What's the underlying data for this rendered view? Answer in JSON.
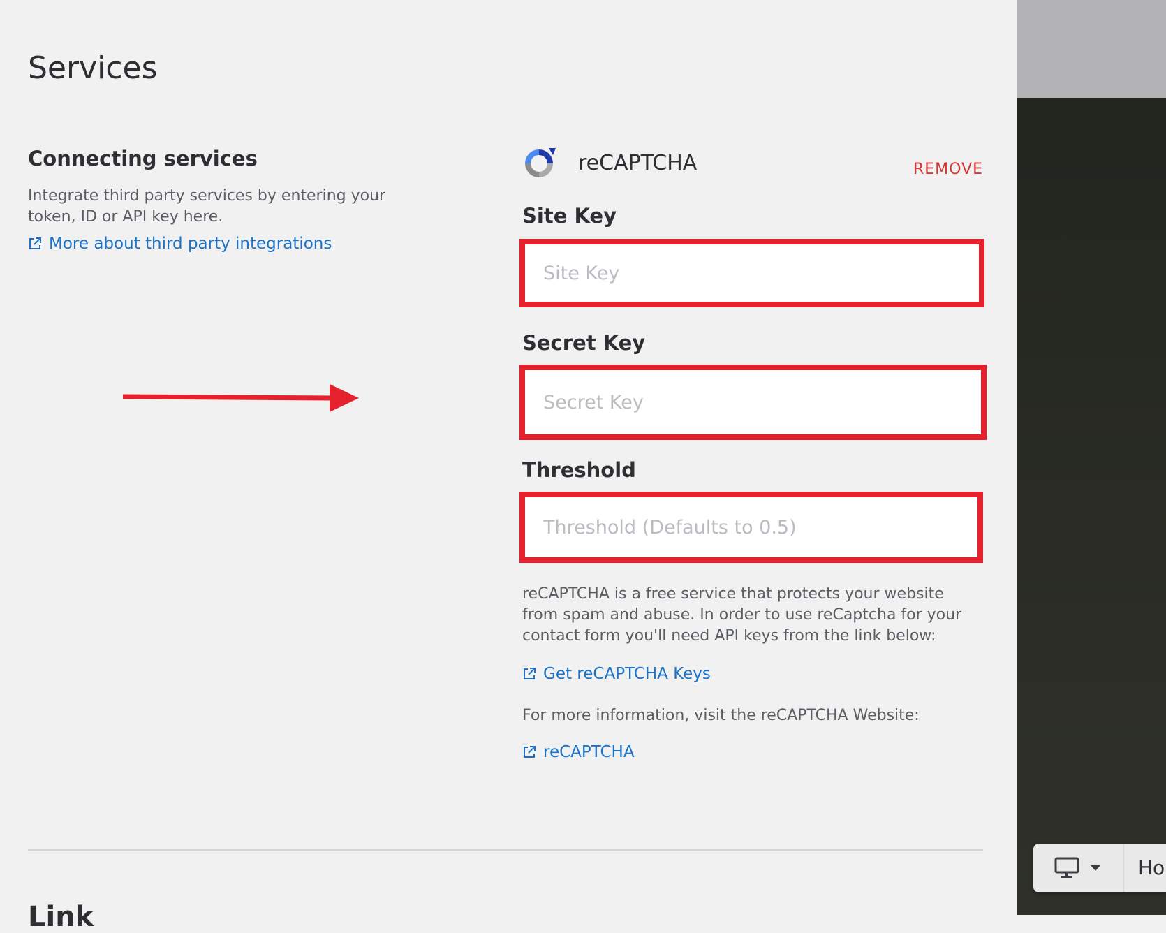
{
  "page": {
    "title": "Services"
  },
  "left": {
    "heading": "Connecting services",
    "description": "Integrate third party services by entering your token, ID or API key here.",
    "link_label": "More about third party integrations"
  },
  "service": {
    "name": "reCAPTCHA",
    "remove_label": "REMOVE",
    "fields": [
      {
        "label": "Site Key",
        "placeholder": "Site Key",
        "value": ""
      },
      {
        "label": "Secret Key",
        "placeholder": "Secret Key",
        "value": ""
      },
      {
        "label": "Threshold",
        "placeholder": "Threshold (Defaults to 0.5)",
        "value": ""
      }
    ],
    "info_text": "reCAPTCHA is a free service that protects your website from spam and abuse. In order to use reCaptcha for your contact form you'll need API keys from the link below:",
    "keys_link_label": "Get reCAPTCHA Keys",
    "more_info_text": "For more information, visit the reCAPTCHA Website:",
    "website_link_label": "reCAPTCHA"
  },
  "next_section": {
    "heading_partial": "Link"
  },
  "preview": {
    "device_label": "Ho",
    "device_icon": "monitor-icon"
  },
  "colors": {
    "highlight": "#e5212e",
    "link": "#1a73c8",
    "remove": "#d93636"
  }
}
